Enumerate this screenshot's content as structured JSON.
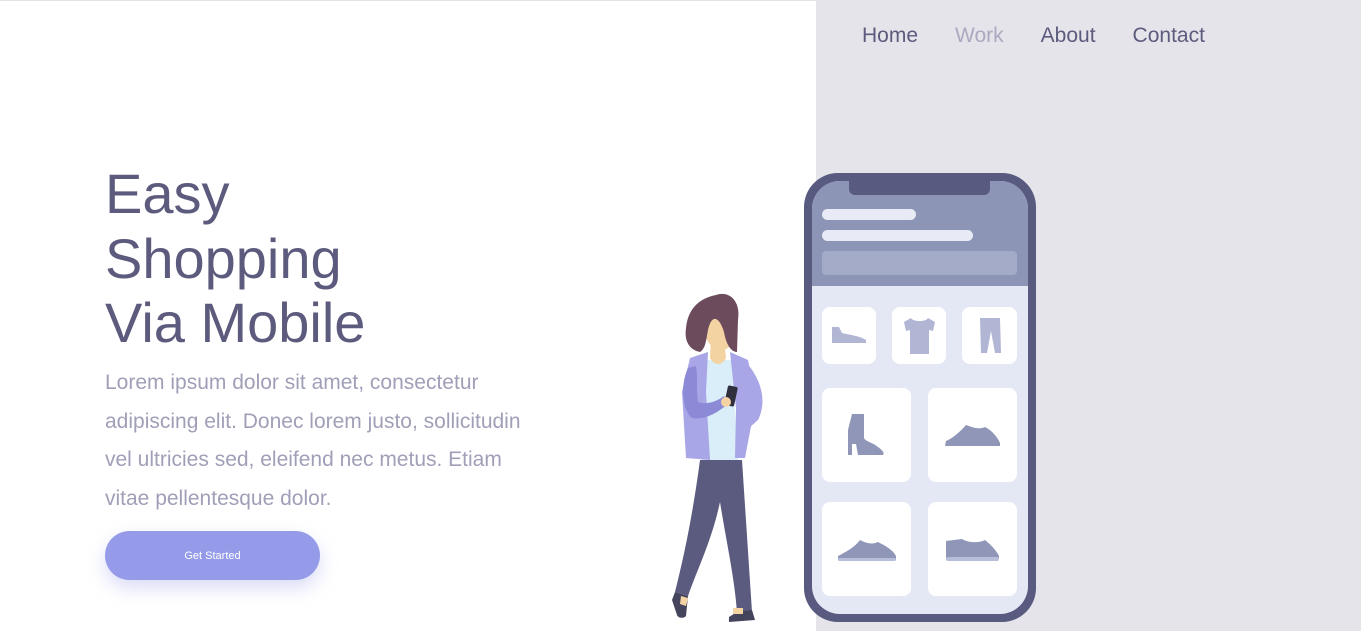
{
  "nav": {
    "items": [
      {
        "label": "Home",
        "active": false
      },
      {
        "label": "Work",
        "active": true
      },
      {
        "label": "About",
        "active": false
      },
      {
        "label": "Contact",
        "active": false
      }
    ]
  },
  "hero": {
    "title_lines": [
      "Easy",
      "Shopping",
      "Via Mobile"
    ],
    "description": "Lorem ipsum dolor sit amet, consectetur adipiscing elit. Donec lorem justo, sollicitudin vel ultricies sed, eleifend nec metus. Etiam vitae pellentesque dolor.",
    "cta_label": "Get Started"
  },
  "colors": {
    "primary_text": "#5c5b7d",
    "muted_text": "#a09fb8",
    "nav_active": "#aaa9bf",
    "accent": "#959be9",
    "panel_bg": "#e5e4ea",
    "phone_frame": "#585a80"
  },
  "illustration": {
    "product_icons": [
      "shoe-icon",
      "tshirt-icon",
      "pants-icon",
      "boot-icon",
      "sneaker-icon",
      "sneaker-icon",
      "sneaker-icon"
    ]
  }
}
